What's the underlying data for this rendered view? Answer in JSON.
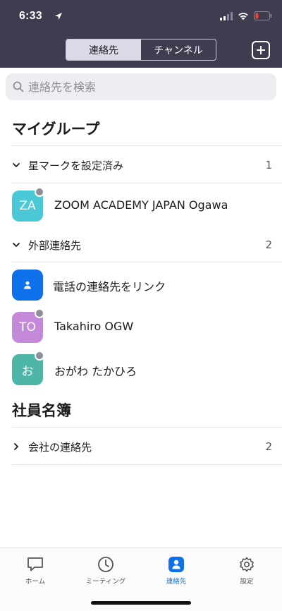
{
  "status_bar": {
    "time": "6:33"
  },
  "header": {
    "tabs": [
      {
        "label": "連絡先",
        "active": true
      },
      {
        "label": "チャンネル",
        "active": false
      }
    ]
  },
  "search": {
    "placeholder": "連絡先を検索"
  },
  "sections": {
    "my_groups": "マイグループ",
    "directory": "社員名簿"
  },
  "groups": {
    "starred": {
      "label": "星マークを設定済み",
      "count": "1"
    },
    "external": {
      "label": "外部連絡先",
      "count": "2"
    },
    "company": {
      "label": "会社の連絡先",
      "count": "2"
    }
  },
  "contacts": {
    "starred": [
      {
        "initials": "ZA",
        "name": "ZOOM ACADEMY JAPAN Ogawa",
        "color": "#4bc8d6"
      }
    ],
    "external": [
      {
        "initials": "",
        "name": "電話の連絡先をリンク",
        "color": "#0e71eb"
      },
      {
        "initials": "TO",
        "name": "Takahiro OGW",
        "color": "#c589d9"
      },
      {
        "initials": "お",
        "name": "おがわ たかひろ",
        "color": "#4db6a6"
      }
    ]
  },
  "tabbar": [
    {
      "label": "ホーム",
      "icon": "chat-bubble-icon"
    },
    {
      "label": "ミーティング",
      "icon": "clock-icon"
    },
    {
      "label": "連絡先",
      "icon": "contacts-icon",
      "active": true
    },
    {
      "label": "設定",
      "icon": "gear-icon"
    }
  ],
  "colors": {
    "header_bg": "#3f3c4f",
    "accent": "#0e71eb"
  }
}
